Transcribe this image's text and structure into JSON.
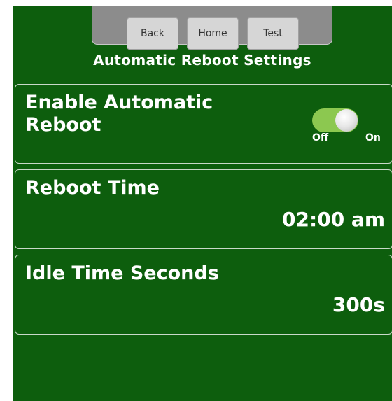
{
  "nav": {
    "back_label": "Back",
    "home_label": "Home",
    "test_label": "Test"
  },
  "page": {
    "title": "Automatic Reboot Settings"
  },
  "settings": {
    "auto_reboot": {
      "label": "Enable Automatic\nReboot",
      "toggle_off_label": "Off",
      "toggle_on_label": "On",
      "enabled": true
    },
    "reboot_time": {
      "label": "Reboot Time",
      "value": "02:00 am"
    },
    "idle_time": {
      "label": "Idle Time Seconds",
      "value": "300s"
    }
  },
  "colors": {
    "background": "#0d5e0d",
    "toggle_on": "#8cc850",
    "nav_bar": "#8c8c8c"
  }
}
